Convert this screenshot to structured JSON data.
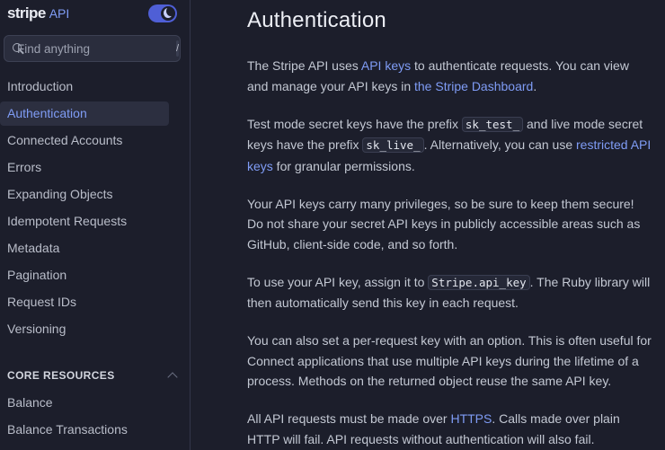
{
  "brand": {
    "logo": "stripe",
    "api": "API"
  },
  "search": {
    "placeholder": "Find anything",
    "shortcut": "/"
  },
  "sidebar": {
    "items": [
      {
        "label": "Introduction",
        "active": false
      },
      {
        "label": "Authentication",
        "active": true
      },
      {
        "label": "Connected Accounts",
        "active": false
      },
      {
        "label": "Errors",
        "active": false
      },
      {
        "label": "Expanding Objects",
        "active": false
      },
      {
        "label": "Idempotent Requests",
        "active": false
      },
      {
        "label": "Metadata",
        "active": false
      },
      {
        "label": "Pagination",
        "active": false
      },
      {
        "label": "Request IDs",
        "active": false
      },
      {
        "label": "Versioning",
        "active": false
      }
    ],
    "section_title": "CORE RESOURCES",
    "section_items": [
      {
        "label": "Balance"
      },
      {
        "label": "Balance Transactions"
      }
    ]
  },
  "main": {
    "title": "Authentication",
    "p1": {
      "t1": "The Stripe API uses ",
      "link1": "API keys",
      "t2": " to authenticate requests. You can view and manage your API keys in ",
      "link2": "the Stripe Dashboard",
      "t3": "."
    },
    "p2": {
      "t1": "Test mode secret keys have the prefix ",
      "code1": "sk_test_",
      "t2": " and live mode secret keys have the prefix ",
      "code2": "sk_live_",
      "t3": ". Alternatively, you can use ",
      "link1": "restricted API keys",
      "t4": " for granular permissions."
    },
    "p3": "Your API keys carry many privileges, so be sure to keep them secure! Do not share your secret API keys in publicly accessible areas such as GitHub, client-side code, and so forth.",
    "p4": {
      "t1": "To use your API key, assign it to ",
      "code1": "Stripe.api_key",
      "t2": ". The Ruby library will then automatically send this key in each request."
    },
    "p5": "You can also set a per-request key with an option. This is often useful for Connect applications that use multiple API keys during the lifetime of a process. Methods on the returned object reuse the same API key.",
    "p6": {
      "t1": "All API requests must be made over ",
      "link1": "HTTPS",
      "t2": ". Calls made over plain HTTP will fail. API requests without authentication will also fail."
    }
  },
  "colors": {
    "background": "#1c1e2b",
    "accent": "#7f9cf5",
    "toggle": "#4f5fd6"
  }
}
